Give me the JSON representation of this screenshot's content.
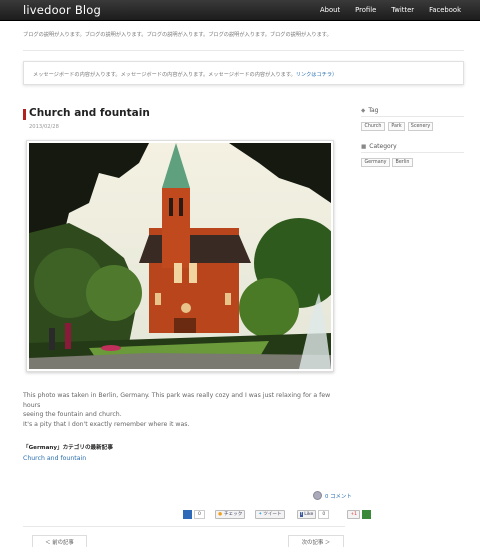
{
  "header": {
    "logo": "livedoor Blog",
    "nav": [
      "About",
      "Profile",
      "Twitter",
      "Facebook"
    ]
  },
  "description": "ブログの説明が入ります。ブログの説明が入ります。ブログの説明が入ります。ブログの説明が入ります。ブログの説明が入ります。",
  "message": {
    "text": "メッセージボードの内容が入ります。メッセージボードの内容が入ります。メッセージボードの内容が入ります。",
    "link": "リンクはコチラ",
    "suffix": "）"
  },
  "post": {
    "title": "Church and fountain",
    "date": "2013/02/28",
    "body_lines": [
      "This photo was taken in Berlin, Germany. This park was really cozy and I was just relaxing for a few hours",
      "seeing the fountain and church.",
      "It's a pity that I don't exactly remember where it was."
    ],
    "related_heading": "「Germany」カテゴリの最新記事",
    "related_link": "Church and fountain",
    "comment": "0 コメント"
  },
  "share": {
    "hatena_count": "0",
    "check_label": "チェック",
    "tweet_label": "ツイート",
    "like_label": "Like",
    "like_count": "0",
    "gplus_label": "+1"
  },
  "pager": {
    "prev": "＜ 前の記事",
    "next": "次の記事 ＞"
  },
  "sidebar": {
    "tag_heading": "Tag",
    "tags": [
      "Church",
      "Park",
      "Scenery"
    ],
    "category_heading": "Category",
    "categories": [
      "Germany",
      "Berlin"
    ]
  },
  "colors": {
    "accent": "#b22222",
    "link": "#2a6fb0",
    "header_bg": "#2a2a2a"
  }
}
